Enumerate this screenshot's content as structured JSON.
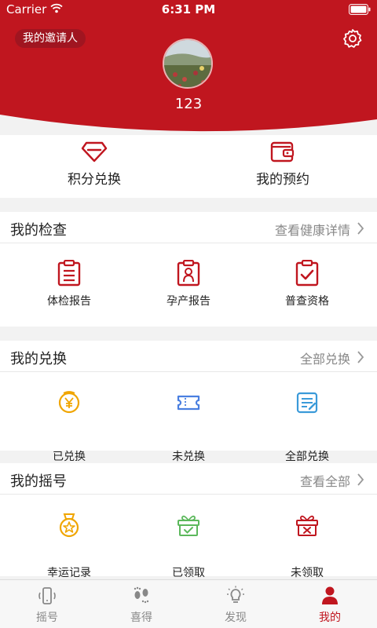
{
  "status_bar": {
    "carrier": "Carrier",
    "time": "6:31 PM"
  },
  "header": {
    "inviter_label": "我的邀请人",
    "username": "123"
  },
  "quick_actions": [
    {
      "label": "积分兑换",
      "icon": "diamond-icon"
    },
    {
      "label": "我的预约",
      "icon": "wallet-icon"
    }
  ],
  "sections": {
    "checkups": {
      "title": "我的检查",
      "link": "查看健康详情",
      "items": [
        {
          "label": "体检报告",
          "icon": "clipboard-list-icon"
        },
        {
          "label": "孕产报告",
          "icon": "baby-badge-icon"
        },
        {
          "label": "普查资格",
          "icon": "clipboard-check-icon"
        }
      ]
    },
    "exchanges": {
      "title": "我的兑换",
      "link": "全部兑换",
      "items": [
        {
          "label": "已兑换",
          "icon": "yen-coin-icon"
        },
        {
          "label": "未兑换",
          "icon": "ticket-icon"
        },
        {
          "label": "全部兑换",
          "icon": "document-edit-icon"
        }
      ]
    },
    "lottery": {
      "title": "我的摇号",
      "link": "查看全部",
      "items": [
        {
          "label": "幸运记录",
          "icon": "star-medal-icon"
        },
        {
          "label": "已领取",
          "icon": "gift-check-icon"
        },
        {
          "label": "未领取",
          "icon": "gift-x-icon"
        }
      ]
    }
  },
  "tabs": [
    {
      "label": "摇号",
      "icon": "shake-phone-icon",
      "active": false
    },
    {
      "label": "喜得",
      "icon": "footprints-icon",
      "active": false
    },
    {
      "label": "发现",
      "icon": "lightbulb-icon",
      "active": false
    },
    {
      "label": "我的",
      "icon": "person-icon",
      "active": true
    }
  ],
  "colors": {
    "brand_red": "#c0161f",
    "yellow": "#f0a500",
    "blue": "#4a7fe0",
    "green": "#5cb85c"
  }
}
